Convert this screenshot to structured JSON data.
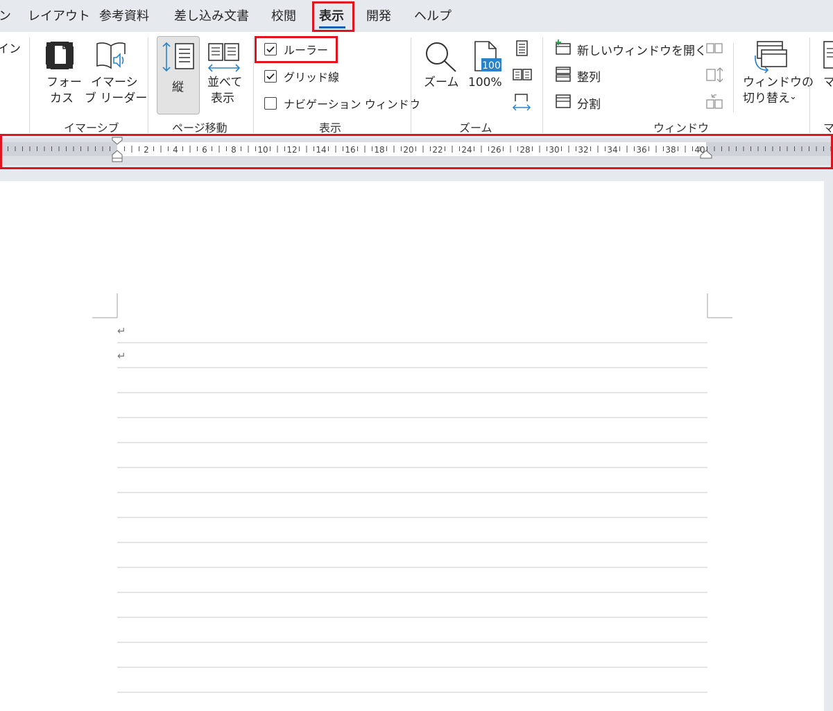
{
  "tabs": [
    {
      "label": "ン",
      "active": false
    },
    {
      "label": "レイアウト",
      "active": false
    },
    {
      "label": "参考資料",
      "active": false
    },
    {
      "label": "差し込み文書",
      "active": false
    },
    {
      "label": "校閲",
      "active": false
    },
    {
      "label": "表示",
      "active": true
    },
    {
      "label": "開発",
      "active": false
    },
    {
      "label": "ヘルプ",
      "active": false
    }
  ],
  "ribbon": {
    "left_partial": "イン",
    "immersive": {
      "group_label": "イマーシブ",
      "focus_label_1": "フォー",
      "focus_label_2": "カス",
      "reader_label_1": "イマーシ",
      "reader_label_2": "ブ リーダー"
    },
    "page_movement": {
      "group_label": "ページ移動",
      "vertical_label": "縦",
      "side_label_1": "並べて",
      "side_label_2": "表示"
    },
    "show": {
      "group_label": "表示",
      "checkboxes": [
        {
          "label": "ルーラー",
          "checked": true
        },
        {
          "label": "グリッド線",
          "checked": true
        },
        {
          "label": "ナビゲーション ウィンドウ",
          "checked": false
        }
      ]
    },
    "zoom": {
      "group_label": "ズーム",
      "zoom_label": "ズーム",
      "percent_label": "100%",
      "icon_number": "100"
    },
    "window": {
      "group_label": "ウィンドウ",
      "new_window": "新しいウィンドウを開く",
      "arrange": "整列",
      "split": "分割",
      "switch_label_1": "ウィンドウの",
      "switch_label_2": "切り替え"
    },
    "right_partial_top": "マ",
    "right_partial_bottom": "マ"
  },
  "ruler": {
    "numbers": [
      "2",
      "4",
      "6",
      "8",
      "10",
      "12",
      "14",
      "16",
      "18",
      "20",
      "22",
      "24",
      "26",
      "28",
      "30",
      "32",
      "34",
      "36",
      "38",
      "40"
    ]
  },
  "document": {
    "paragraph_marks": [
      "↵",
      "↵"
    ]
  },
  "colors": {
    "accent": "#1a5fb4",
    "highlight": "#e0141e",
    "icon_blue": "#2a83c9"
  }
}
